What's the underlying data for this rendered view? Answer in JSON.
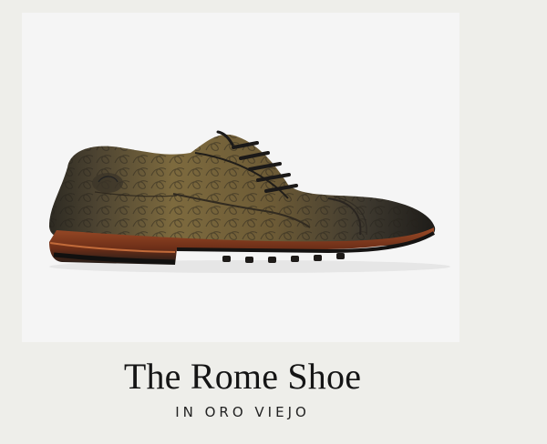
{
  "product": {
    "title": "The Rome Shoe",
    "subtitle": "IN ORO VIEJO",
    "image_icon": "embossed-leather-derby-shoe"
  },
  "colors": {
    "page_background": "#eeeeea",
    "photo_background": "#f5f5f5",
    "text": "#151515"
  }
}
